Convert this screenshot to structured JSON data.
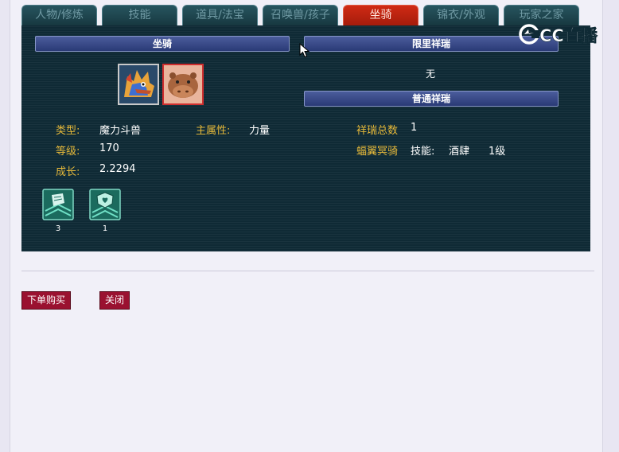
{
  "tabs": [
    {
      "label": "人物/修炼",
      "active": false
    },
    {
      "label": "技能",
      "active": false
    },
    {
      "label": "道具/法宝",
      "active": false
    },
    {
      "label": "召唤兽/孩子",
      "active": false
    },
    {
      "label": "坐骑",
      "active": true
    },
    {
      "label": "锦衣/外观",
      "active": false
    },
    {
      "label": "玩家之家",
      "active": false
    }
  ],
  "mount": {
    "section_title": "坐骑",
    "slots": [
      {
        "icon": "dragon-mount-icon"
      },
      {
        "icon": "hippo-mount-icon",
        "selected": true
      }
    ],
    "type_label": "类型:",
    "type_value": "魔力斗兽",
    "attr_label": "主属性:",
    "attr_value": "力量",
    "level_label": "等级:",
    "level_value": "170",
    "growth_label": "成长:",
    "growth_value": "2.2294"
  },
  "xiangrui": {
    "limited_title": "限里祥瑞",
    "limited_value": "无",
    "normal_title": "普通祥瑞",
    "total_label": "祥瑞总数",
    "total_value": "1",
    "item_name": "蝠翼冥骑",
    "skill_label": "技能:",
    "skill_name": "酒肆",
    "skill_level": "1级"
  },
  "skills": [
    {
      "icon": "scroll-skill-icon",
      "count": "3"
    },
    {
      "icon": "shield-skill-icon",
      "count": "1"
    }
  ],
  "buttons": {
    "buy": "下单购买",
    "close": "关闭"
  },
  "watermark": {
    "text": "CC直播"
  }
}
